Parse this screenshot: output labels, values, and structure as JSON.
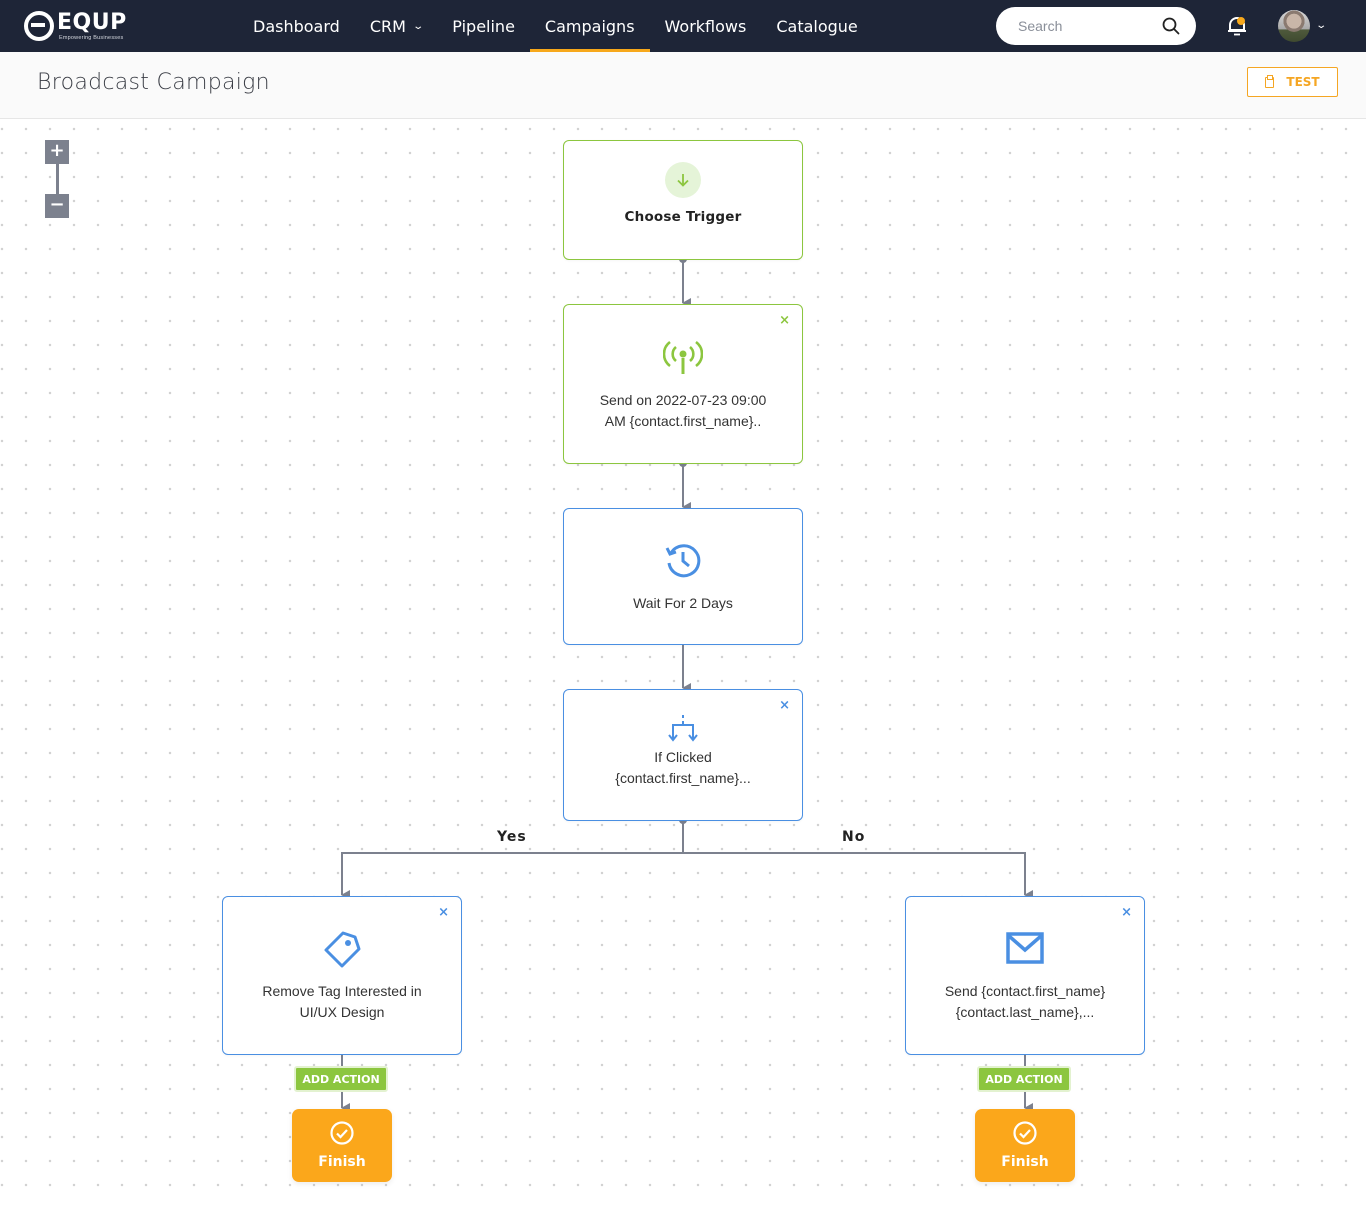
{
  "app": {
    "logo_text": "EQUP",
    "logo_tagline": "Empowering Businesses"
  },
  "nav": {
    "items": [
      {
        "label": "Dashboard",
        "has_dropdown": false,
        "active": false
      },
      {
        "label": "CRM",
        "has_dropdown": true,
        "active": false
      },
      {
        "label": "Pipeline",
        "has_dropdown": false,
        "active": false
      },
      {
        "label": "Campaigns",
        "has_dropdown": false,
        "active": true
      },
      {
        "label": "Workflows",
        "has_dropdown": false,
        "active": false
      },
      {
        "label": "Catalogue",
        "has_dropdown": false,
        "active": false
      }
    ],
    "dropdown_glyph": "⌄",
    "search": {
      "placeholder": "Search",
      "value": ""
    },
    "notification_icon": "bell-icon",
    "notification_badge_color": "#f7a81b",
    "user_menu_glyph": "⌄"
  },
  "header": {
    "title": "Broadcast Campaign",
    "test_button_label": "TEST",
    "test_button_icon": "clipboard-icon"
  },
  "zoom": {
    "in_label": "+",
    "out_label": "−"
  },
  "flow": {
    "trigger": {
      "label": "Choose Trigger",
      "icon": "arrow-down-icon"
    },
    "broadcast": {
      "line1": "Send on 2022-07-23 09:00",
      "line2": "AM {contact.first_name}..",
      "icon": "broadcast-antenna-icon",
      "close": "×"
    },
    "wait": {
      "label": "Wait For 2 Days",
      "icon": "history-clock-icon"
    },
    "condition": {
      "line1": "If Clicked",
      "line2": "{contact.first_name}...",
      "icon": "split-branch-icon",
      "close": "×"
    },
    "branches": {
      "yes_label": "Yes",
      "no_label": "No"
    },
    "yes_action": {
      "line1": "Remove Tag Interested in",
      "line2": "UI/UX Design",
      "icon": "tag-icon",
      "close": "×"
    },
    "no_action": {
      "line1": "Send {contact.first_name}",
      "line2": "{contact.last_name},...",
      "icon": "envelope-icon",
      "close": "×"
    },
    "add_action_label": "ADD ACTION",
    "finish_label": "Finish"
  },
  "colors": {
    "nav_bg": "#1e2537",
    "accent_orange": "#f7a81b",
    "finish_orange": "#fba71b",
    "trigger_green": "#8cc63f",
    "action_blue": "#4a8fe2",
    "connector_gray": "#7c818e"
  }
}
